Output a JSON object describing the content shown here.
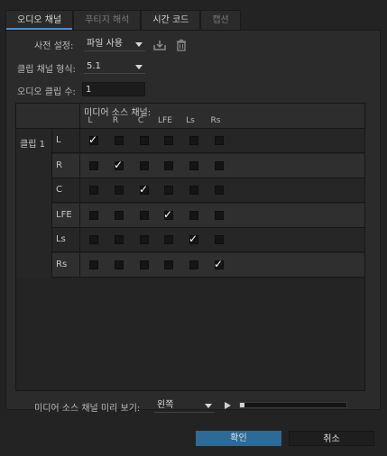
{
  "tabs": [
    {
      "label": "오디오 채널",
      "active": true
    },
    {
      "label": "푸티지 해석",
      "active": false
    },
    {
      "label": "시간 코드",
      "active": false
    },
    {
      "label": "캡션",
      "active": false
    }
  ],
  "preset": {
    "label": "사전 설정:",
    "value": "파일 사용"
  },
  "clip_channel_format": {
    "label": "클립 채널 형식:",
    "value": "5.1"
  },
  "audio_clip_count": {
    "label": "오디오 클립 수:",
    "value": "1"
  },
  "grid": {
    "media_source_channel_label": "미디어 소스 채널:",
    "columns": [
      "L",
      "R",
      "C",
      "LFE",
      "Ls",
      "Rs"
    ],
    "clip_label": "클립 1",
    "rows": [
      {
        "name": "L",
        "checked": [
          true,
          false,
          false,
          false,
          false,
          false
        ]
      },
      {
        "name": "R",
        "checked": [
          false,
          true,
          false,
          false,
          false,
          false
        ]
      },
      {
        "name": "C",
        "checked": [
          false,
          false,
          true,
          false,
          false,
          false
        ]
      },
      {
        "name": "LFE",
        "checked": [
          false,
          false,
          false,
          true,
          false,
          false
        ]
      },
      {
        "name": "Ls",
        "checked": [
          false,
          false,
          false,
          false,
          true,
          false
        ]
      },
      {
        "name": "Rs",
        "checked": [
          false,
          false,
          false,
          false,
          false,
          true
        ]
      }
    ]
  },
  "preview": {
    "label": "미디어 소스 채널 미리 보기:",
    "value": "왼쪽",
    "progress": 0
  },
  "buttons": {
    "ok": "확인",
    "cancel": "취소"
  },
  "colors": {
    "accent": "#2d6a96",
    "tab_highlight": "#4a8fd3",
    "background": "#232323"
  }
}
